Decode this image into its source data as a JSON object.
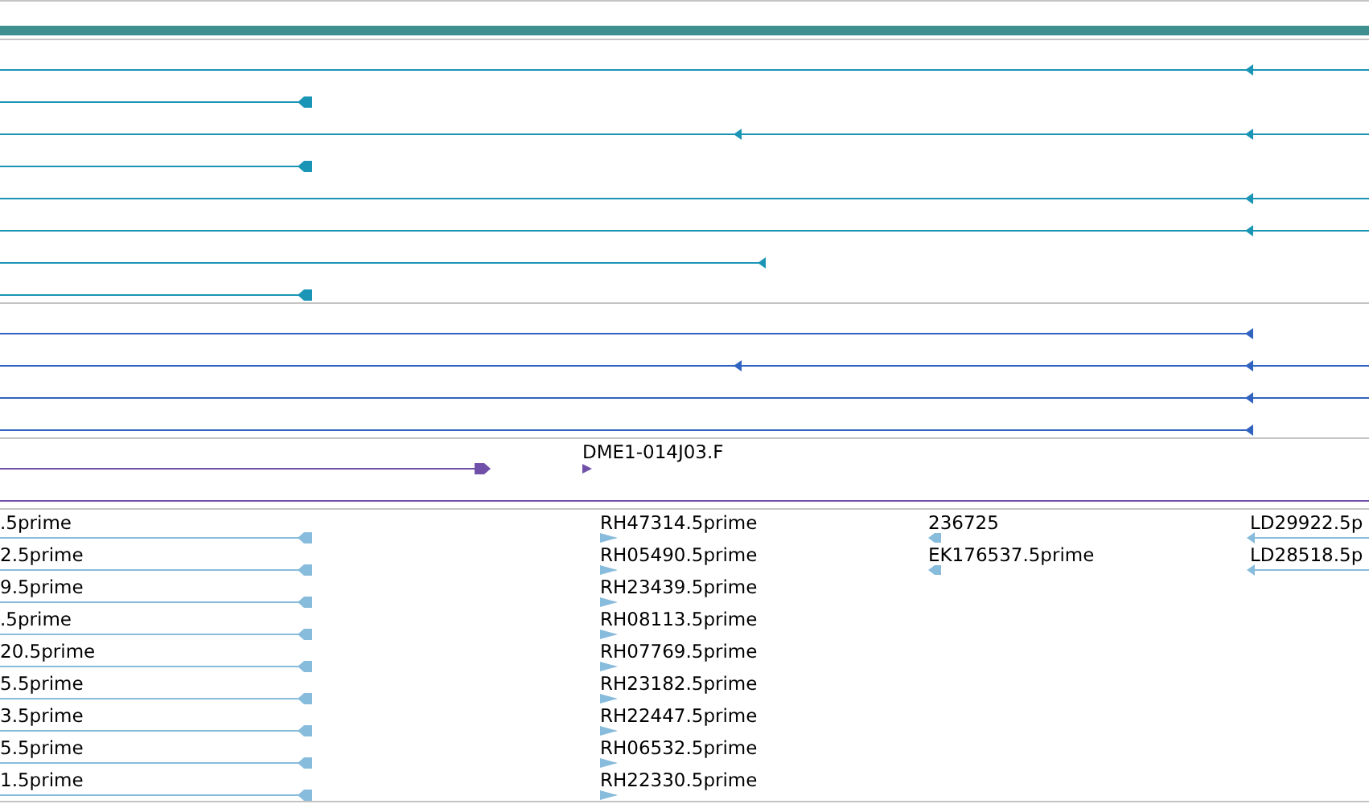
{
  "tracks": [
    {
      "kind": "scale",
      "color": "#3f8f91"
    },
    {
      "kind": "transcripts",
      "color": "#1a95b5"
    },
    {
      "kind": "transcripts",
      "color": "#3064c0"
    },
    {
      "kind": "match",
      "color": "#7050a8",
      "labels": [
        "DME1-014J03.F"
      ]
    },
    {
      "kind": "est",
      "color": "#88bcdc",
      "columns": [
        {
          "labels": [
            ".5prime",
            "2.5prime",
            "9.5prime",
            ".5prime",
            "20.5prime",
            "5.5prime",
            "3.5prime",
            "5.5prime",
            "1.5prime"
          ]
        },
        {
          "labels": [
            "RH47314.5prime",
            "RH05490.5prime",
            "RH23439.5prime",
            "RH08113.5prime",
            "RH07769.5prime",
            "RH23182.5prime",
            "RH22447.5prime",
            "RH06532.5prime",
            "RH22330.5prime"
          ]
        },
        {
          "labels": [
            "236725",
            "EK176537.5prime"
          ]
        },
        {
          "labels": [
            "LD29922.5p",
            "LD28518.5p"
          ]
        }
      ]
    }
  ]
}
